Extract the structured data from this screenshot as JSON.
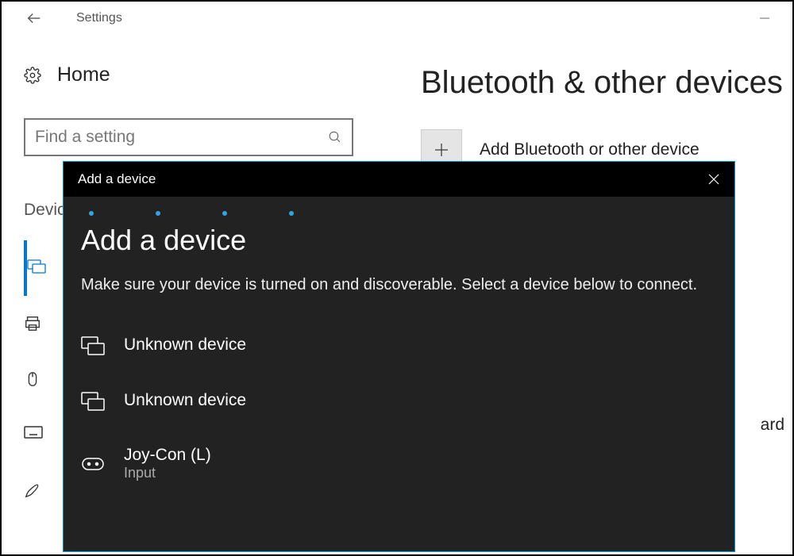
{
  "app": {
    "title": "Settings"
  },
  "sidebar": {
    "home_label": "Home",
    "search_placeholder": "Find a setting",
    "devices_heading": "Devices"
  },
  "main": {
    "heading": "Bluetooth & other devices",
    "add_label": "Add Bluetooth or other device",
    "partial_text": "ard"
  },
  "dialog": {
    "titlebar": "Add a device",
    "heading": "Add a device",
    "description": "Make sure your device is turned on and discoverable. Select a device below to connect.",
    "devices": [
      {
        "name": "Unknown device",
        "sub": ""
      },
      {
        "name": "Unknown device",
        "sub": ""
      },
      {
        "name": "Joy-Con (L)",
        "sub": "Input"
      }
    ]
  }
}
